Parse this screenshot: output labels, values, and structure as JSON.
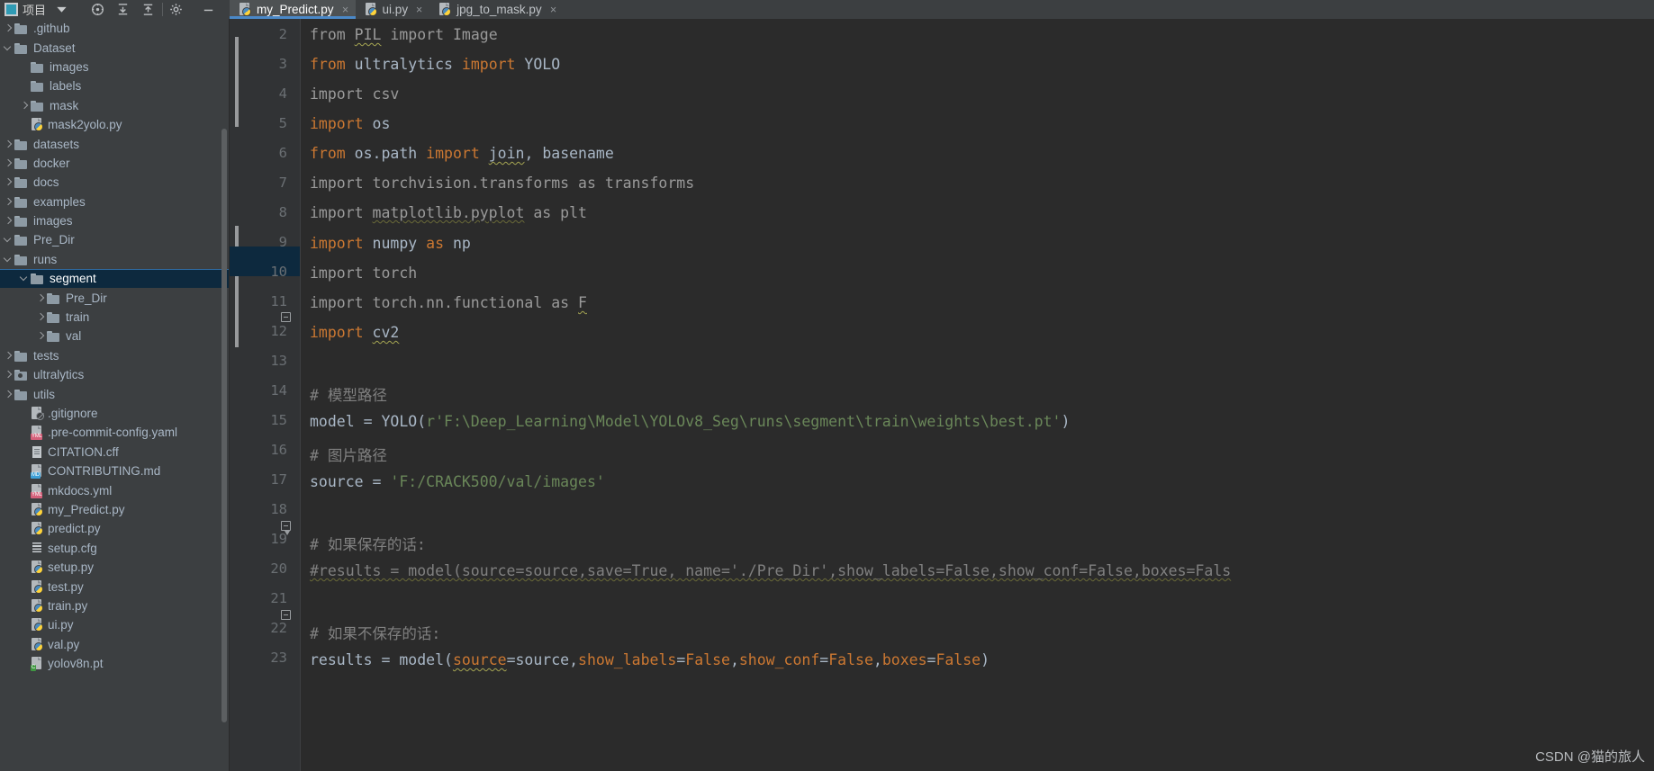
{
  "toolbar": {
    "project_label": "项目",
    "icons": [
      "project-square-icon",
      "chevron-down-icon",
      "locate-icon",
      "collapse-down-icon",
      "collapse-up-icon",
      "gear-icon",
      "minimize-icon"
    ]
  },
  "sidebar": {
    "items": [
      {
        "label": ".github",
        "type": "folder",
        "depth": 1,
        "arrow": "closed",
        "selected": false
      },
      {
        "label": "Dataset",
        "type": "folder",
        "depth": 1,
        "arrow": "open",
        "selected": false
      },
      {
        "label": "images",
        "type": "folder",
        "depth": 2,
        "arrow": "none",
        "selected": false
      },
      {
        "label": "labels",
        "type": "folder",
        "depth": 2,
        "arrow": "none",
        "selected": false
      },
      {
        "label": "mask",
        "type": "folder",
        "depth": 2,
        "arrow": "closed",
        "selected": false
      },
      {
        "label": "mask2yolo.py",
        "type": "py",
        "depth": 2,
        "arrow": "none",
        "selected": false
      },
      {
        "label": "datasets",
        "type": "folder",
        "depth": 1,
        "arrow": "closed",
        "selected": false
      },
      {
        "label": "docker",
        "type": "folder",
        "depth": 1,
        "arrow": "closed",
        "selected": false
      },
      {
        "label": "docs",
        "type": "folder",
        "depth": 1,
        "arrow": "closed",
        "selected": false
      },
      {
        "label": "examples",
        "type": "folder",
        "depth": 1,
        "arrow": "closed",
        "selected": false
      },
      {
        "label": "images",
        "type": "folder",
        "depth": 1,
        "arrow": "closed",
        "selected": false
      },
      {
        "label": "Pre_Dir",
        "type": "folder",
        "depth": 1,
        "arrow": "open",
        "selected": false
      },
      {
        "label": "runs",
        "type": "folder",
        "depth": 1,
        "arrow": "open",
        "selected": false
      },
      {
        "label": "segment",
        "type": "folder",
        "depth": 2,
        "arrow": "open",
        "selected": true
      },
      {
        "label": "Pre_Dir",
        "type": "folder",
        "depth": 3,
        "arrow": "closed",
        "selected": false
      },
      {
        "label": "train",
        "type": "folder",
        "depth": 3,
        "arrow": "closed",
        "selected": false
      },
      {
        "label": "val",
        "type": "folder",
        "depth": 3,
        "arrow": "closed",
        "selected": false
      },
      {
        "label": "tests",
        "type": "folder",
        "depth": 1,
        "arrow": "closed",
        "selected": false
      },
      {
        "label": "ultralytics",
        "type": "module",
        "depth": 1,
        "arrow": "closed",
        "selected": false
      },
      {
        "label": "utils",
        "type": "folder",
        "depth": 1,
        "arrow": "closed",
        "selected": false
      },
      {
        "label": ".gitignore",
        "type": "gitignore",
        "depth": 2,
        "arrow": "none",
        "selected": false
      },
      {
        "label": ".pre-commit-config.yaml",
        "type": "yml",
        "depth": 2,
        "arrow": "none",
        "selected": false
      },
      {
        "label": "CITATION.cff",
        "type": "cff",
        "depth": 2,
        "arrow": "none",
        "selected": false
      },
      {
        "label": "CONTRIBUTING.md",
        "type": "md",
        "depth": 2,
        "arrow": "none",
        "selected": false
      },
      {
        "label": "mkdocs.yml",
        "type": "yml",
        "depth": 2,
        "arrow": "none",
        "selected": false
      },
      {
        "label": "my_Predict.py",
        "type": "py",
        "depth": 2,
        "arrow": "none",
        "selected": false
      },
      {
        "label": "predict.py",
        "type": "py",
        "depth": 2,
        "arrow": "none",
        "selected": false
      },
      {
        "label": "setup.cfg",
        "type": "cfg",
        "depth": 2,
        "arrow": "none",
        "selected": false
      },
      {
        "label": "setup.py",
        "type": "py",
        "depth": 2,
        "arrow": "none",
        "selected": false
      },
      {
        "label": "test.py",
        "type": "py",
        "depth": 2,
        "arrow": "none",
        "selected": false
      },
      {
        "label": "train.py",
        "type": "py",
        "depth": 2,
        "arrow": "none",
        "selected": false
      },
      {
        "label": "ui.py",
        "type": "py",
        "depth": 2,
        "arrow": "none",
        "selected": false
      },
      {
        "label": "val.py",
        "type": "py",
        "depth": 2,
        "arrow": "none",
        "selected": false
      },
      {
        "label": "yolov8n.pt",
        "type": "pt",
        "depth": 2,
        "arrow": "none",
        "selected": false
      }
    ]
  },
  "editor": {
    "tabs": [
      {
        "label": "my_Predict.py",
        "active": true,
        "close_glyph": "×"
      },
      {
        "label": "ui.py",
        "active": false,
        "close_glyph": "×"
      },
      {
        "label": "jpg_to_mask.py",
        "active": false,
        "close_glyph": "×"
      }
    ],
    "line_numbers": [
      "2",
      "3",
      "4",
      "5",
      "6",
      "7",
      "8",
      "9",
      "10",
      "11",
      "12",
      "13",
      "14",
      "15",
      "16",
      "17",
      "18",
      "19",
      "20",
      "21",
      "22",
      "23"
    ],
    "lines": {
      "l2": "from PIL import Image",
      "l3": "from ultralytics import YOLO",
      "l4": "import csv",
      "l5": "import os",
      "l6": "from os.path import join, basename",
      "l7": "import torchvision.transforms as transforms",
      "l8": "import matplotlib.pyplot as plt",
      "l9": "import numpy as np",
      "l10": "import torch",
      "l11": "import torch.nn.functional as F",
      "l12": "import cv2",
      "l13": "",
      "l14": "# 模型路径",
      "l15": "model = YOLO(r'F:\\Deep_Learning\\Model\\YOLOv8_Seg\\runs\\segment\\train\\weights\\best.pt')",
      "l16": "# 图片路径",
      "l17": "source = 'F:/CRACK500/val/images'",
      "l18": "",
      "l19": "# 如果保存的话:",
      "l20": "#results = model(source=source,save=True, name='./Pre_Dir',show_labels=False,show_conf=False,boxes=Fal",
      "l21": "",
      "l22": "# 如果不保存的话:",
      "l23": "results = model(source=source,show_labels=False,show_conf=False,boxes=False)"
    }
  },
  "watermark": {
    "text": "CSDN @猫的旅人"
  }
}
